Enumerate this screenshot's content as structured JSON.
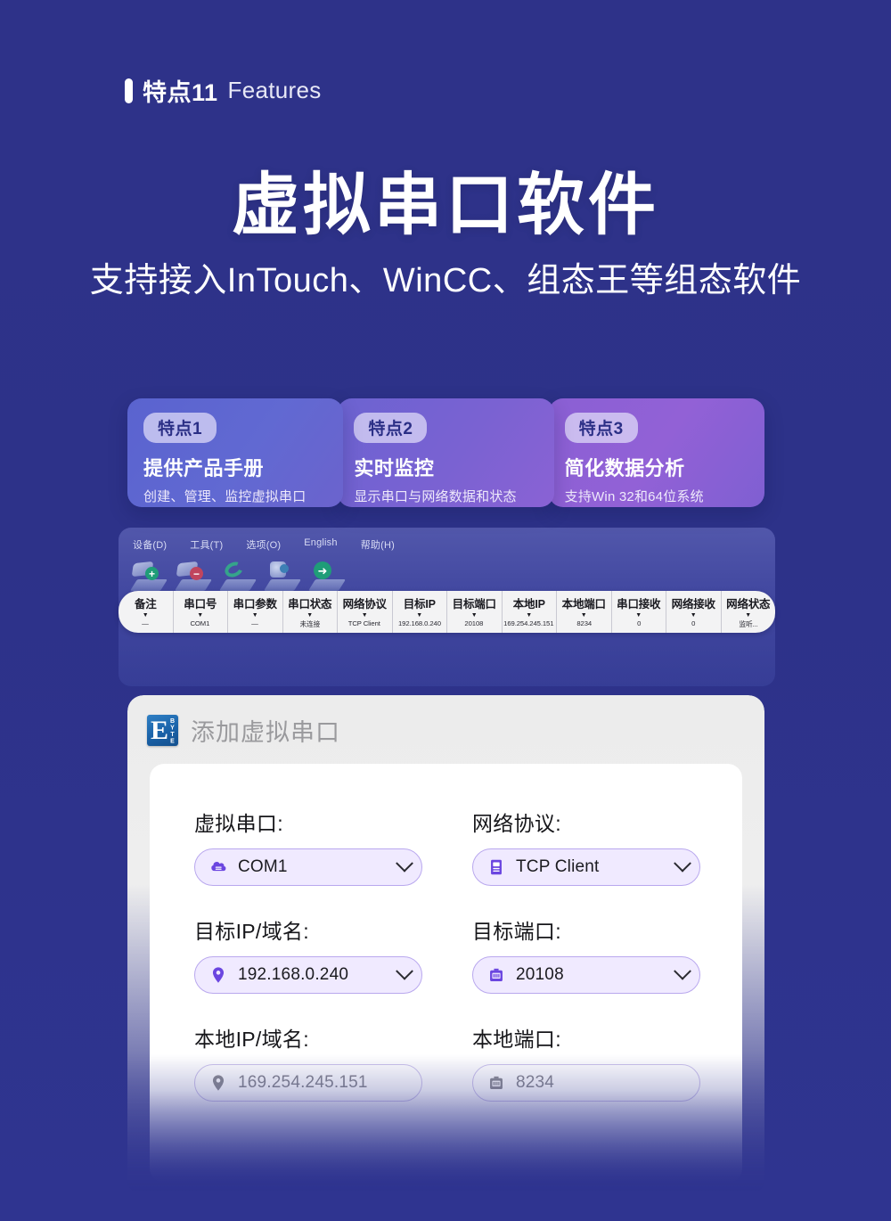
{
  "eyebrow": {
    "cn": "特点11",
    "en": "Features"
  },
  "hero": {
    "title": "虚拟串口软件",
    "subtitle": "支持接入InTouch、WinCC、组态王等组态软件"
  },
  "feature_cards": [
    {
      "badge": "特点1",
      "title": "提供产品手册",
      "desc": "创建、管理、监控虚拟串口",
      "color": "#5a63cf"
    },
    {
      "badge": "特点2",
      "title": "实时监控",
      "desc": "显示串口与网络数据和状态",
      "color": "#7a62d2"
    },
    {
      "badge": "特点3",
      "title": "简化数据分析",
      "desc": "支持Win 32和64位系统",
      "color": "#8a60d4"
    }
  ],
  "app_window": {
    "menu": [
      {
        "label": "设备(D)"
      },
      {
        "label": "工具(T)"
      },
      {
        "label": "选项(O)"
      },
      {
        "label": "English"
      },
      {
        "label": "帮助(H)"
      }
    ],
    "toolbar": [
      {
        "name": "add-virtual-serial-port"
      },
      {
        "name": "remove-virtual-serial-port"
      },
      {
        "name": "refresh"
      },
      {
        "name": "device-settings"
      },
      {
        "name": "start-connection"
      }
    ],
    "table": {
      "columns": [
        {
          "header": "备注",
          "value": "—"
        },
        {
          "header": "串口号",
          "value": "COM1"
        },
        {
          "header": "串口参数",
          "value": "—"
        },
        {
          "header": "串口状态",
          "value": "未连接"
        },
        {
          "header": "网络协议",
          "value": "TCP Client"
        },
        {
          "header": "目标IP",
          "value": "192.168.0.240"
        },
        {
          "header": "目标端口",
          "value": "20108"
        },
        {
          "header": "本地IP",
          "value": "169.254.245.151"
        },
        {
          "header": "本地端口",
          "value": "8234"
        },
        {
          "header": "串口接收",
          "value": "0"
        },
        {
          "header": "网络接收",
          "value": "0"
        },
        {
          "header": "网络状态",
          "value": "监听..."
        }
      ]
    }
  },
  "dialog": {
    "logo_letter": "E",
    "logo_word": "BYTE",
    "title": "添加虚拟串口",
    "fields": [
      {
        "label": "虚拟串口:",
        "value": "COM1",
        "icon": "serial-port-icon",
        "has_chevron": true,
        "disabled": false
      },
      {
        "label": "网络协议:",
        "value": "TCP Client",
        "icon": "protocol-icon",
        "has_chevron": true,
        "disabled": false
      },
      {
        "label": "目标IP/域名:",
        "value": "192.168.0.240",
        "icon": "location-pin-icon",
        "has_chevron": true,
        "disabled": false
      },
      {
        "label": "目标端口:",
        "value": "20108",
        "icon": "port-icon",
        "has_chevron": true,
        "disabled": false
      },
      {
        "label": "本地IP/域名:",
        "value": "169.254.245.151",
        "icon": "location-pin-icon",
        "has_chevron": false,
        "disabled": true
      },
      {
        "label": "本地端口:",
        "value": "8234",
        "icon": "port-icon",
        "has_chevron": false,
        "disabled": true
      }
    ]
  },
  "theme": {
    "background": "#2d3289",
    "accent_purple": "#6b46e0",
    "card_blue": "#5a63cf",
    "card_purple": "#8a60d4"
  }
}
